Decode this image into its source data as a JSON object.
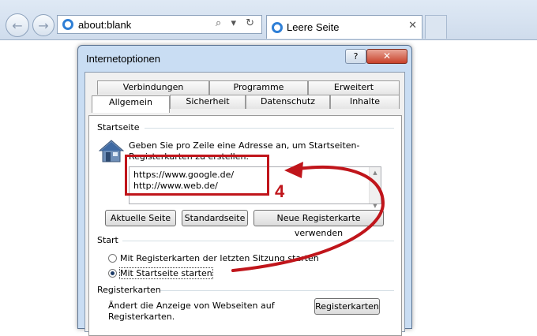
{
  "browser": {
    "address": "about:blank",
    "address_tools": "⌕ ▾ ↻",
    "tab_title": "Leere Seite",
    "tab_close": "✕"
  },
  "dialog": {
    "title": "Internetoptionen",
    "help_label": "?",
    "close_label": "✕",
    "tabs_row1": [
      "Verbindungen",
      "Programme",
      "Erweitert"
    ],
    "tabs_row2": [
      "Allgemein",
      "Sicherheit",
      "Datenschutz",
      "Inhalte"
    ],
    "active_tab": "Allgemein",
    "startseite": {
      "section": "Startseite",
      "description_line1": "Geben Sie pro Zeile eine Adresse an, um Startseiten-",
      "description_line2": "Registerkarten zu erstellen.",
      "url1": "https://www.google.de/",
      "url2": "http://www.web.de/",
      "btn_current": "Aktuelle Seite",
      "btn_default": "Standardseite",
      "btn_newtab": "Neue Registerkarte verwenden"
    },
    "start": {
      "section": "Start",
      "option1": "Mit Registerkarten der letzten Sitzung starten",
      "option2": "Mit Startseite starten",
      "selected": "option2"
    },
    "registerkarten": {
      "section": "Registerkarten",
      "description_line1": "Ändert die Anzeige von Webseiten auf",
      "description_line2": "Registerkarten.",
      "button": "Registerkarten"
    }
  },
  "annotation": {
    "number": "4",
    "color": "#c0151b"
  }
}
